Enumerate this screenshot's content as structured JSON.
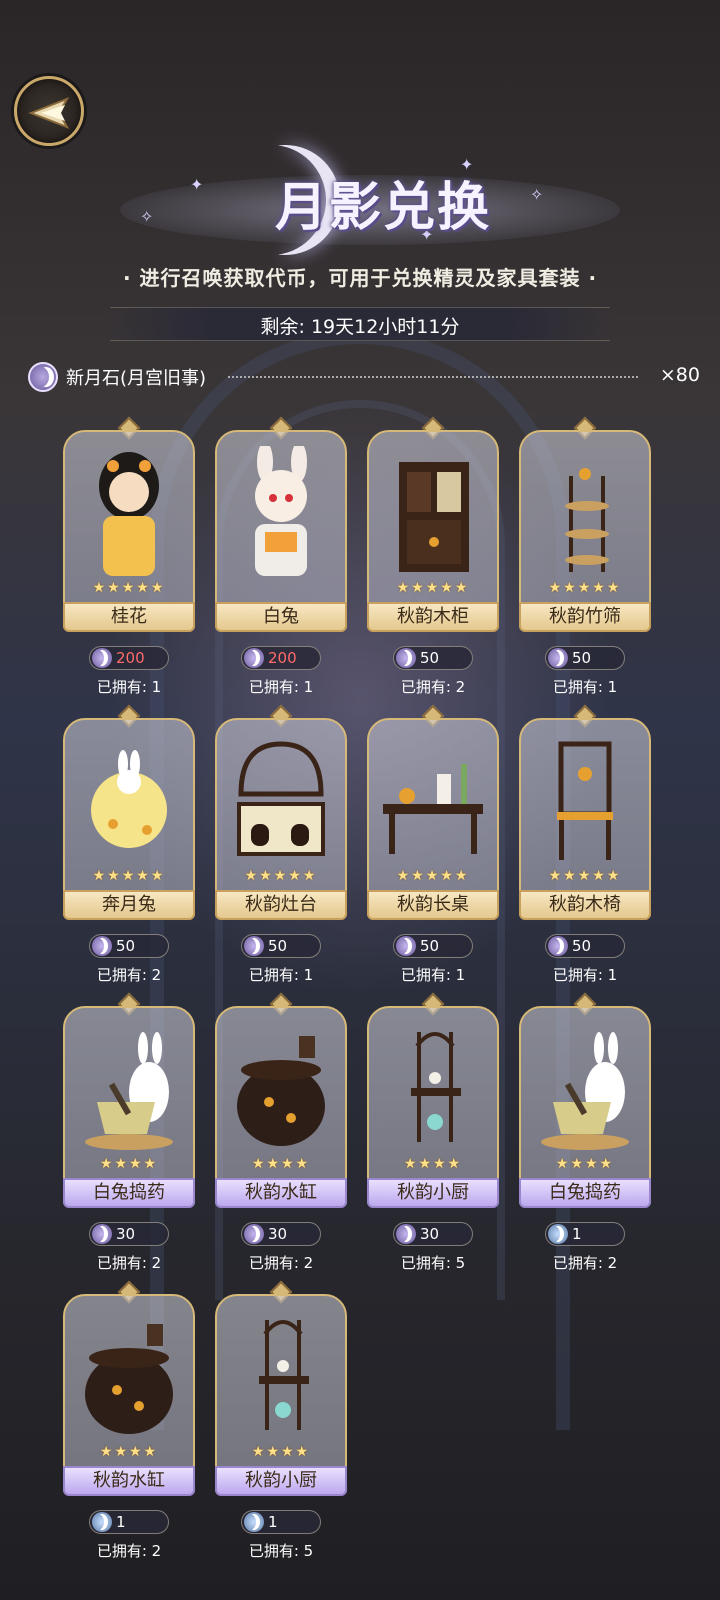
{
  "header": {
    "title": "月影兑换",
    "subtitle": "· 进行召唤获取代币，可用于兑换精灵及家具套装 ·",
    "remaining": "剩余: 19天12小时11分"
  },
  "currency": {
    "name": "新月石(月宫旧事)",
    "amount": "×80"
  },
  "items": [
    {
      "name": "桂花",
      "stars": "★★★★★",
      "price": "200",
      "owned": "已拥有: 1",
      "bar": "gold",
      "price_state": "insufficient",
      "icon": "girl-figure-icon"
    },
    {
      "name": "白兔",
      "stars": "",
      "price": "200",
      "owned": "已拥有: 1",
      "bar": "gold",
      "price_state": "insufficient",
      "icon": "bunny-girl-icon"
    },
    {
      "name": "秋韵木柜",
      "stars": "★★★★★",
      "price": "50",
      "owned": "已拥有: 2",
      "bar": "gold",
      "price_state": "ok",
      "icon": "cabinet-icon"
    },
    {
      "name": "秋韵竹筛",
      "stars": "★★★★★",
      "price": "50",
      "owned": "已拥有: 1",
      "bar": "gold",
      "price_state": "ok",
      "icon": "bamboo-rack-icon"
    },
    {
      "name": "奔月兔",
      "stars": "★★★★★",
      "price": "50",
      "owned": "已拥有: 2",
      "bar": "gold",
      "price_state": "ok",
      "icon": "moon-rabbit-icon"
    },
    {
      "name": "秋韵灶台",
      "stars": "★★★★★",
      "price": "50",
      "owned": "已拥有: 1",
      "bar": "gold",
      "price_state": "ok",
      "icon": "stove-icon"
    },
    {
      "name": "秋韵长桌",
      "stars": "★★★★★",
      "price": "50",
      "owned": "已拥有: 1",
      "bar": "gold",
      "price_state": "ok",
      "icon": "long-table-icon"
    },
    {
      "name": "秋韵木椅",
      "stars": "★★★★★",
      "price": "50",
      "owned": "已拥有: 1",
      "bar": "gold",
      "price_state": "ok",
      "icon": "wooden-chair-icon"
    },
    {
      "name": "白兔捣药",
      "stars": "★★★★",
      "price": "30",
      "owned": "已拥有: 2",
      "bar": "purple",
      "price_state": "ok",
      "icon": "rabbit-mortar-icon"
    },
    {
      "name": "秋韵水缸",
      "stars": "★★★★",
      "price": "30",
      "owned": "已拥有: 2",
      "bar": "purple",
      "price_state": "ok",
      "icon": "water-jar-icon"
    },
    {
      "name": "秋韵小厨",
      "stars": "★★★★",
      "price": "30",
      "owned": "已拥有: 5",
      "bar": "purple",
      "price_state": "ok",
      "icon": "small-kitchen-icon"
    },
    {
      "name": "白兔捣药",
      "stars": "★★★★",
      "price": "1",
      "owned": "已拥有: 2",
      "bar": "purple",
      "price_state": "blue",
      "icon": "rabbit-mortar-icon"
    },
    {
      "name": "秋韵水缸",
      "stars": "★★★★",
      "price": "1",
      "owned": "已拥有: 2",
      "bar": "purple",
      "price_state": "blue",
      "icon": "water-jar-icon"
    },
    {
      "name": "秋韵小厨",
      "stars": "★★★★",
      "price": "1",
      "owned": "已拥有: 5",
      "bar": "purple",
      "price_state": "blue",
      "icon": "small-kitchen-icon"
    }
  ],
  "colors": {
    "gold": "#d6b878",
    "purple": "#bda8ee",
    "insufficient": "#ff6a6a"
  }
}
